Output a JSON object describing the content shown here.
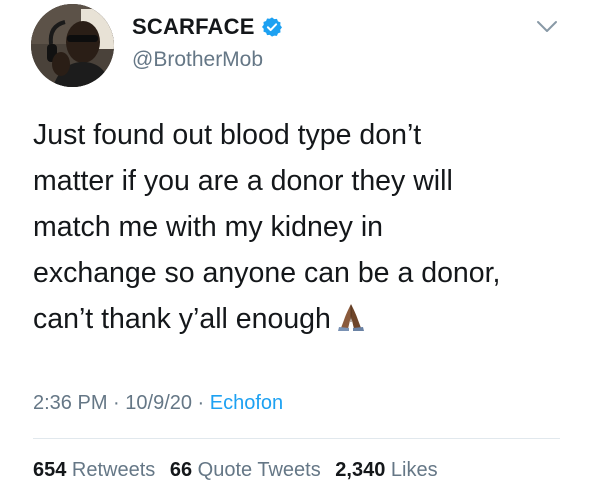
{
  "author": {
    "display_name": "SCARFACE",
    "handle": "@BrotherMob",
    "verified_icon": "verified-badge-icon",
    "accent_color": "#1da1f2"
  },
  "tweet": {
    "lines": [
      "Just found out blood type don’t",
      "matter if you are a donor they will",
      "match me with my kidney in",
      "exchange so anyone can be a donor,",
      "can’t thank y’all enough"
    ],
    "emoji": "folded-hands-icon"
  },
  "meta": {
    "time": "2:36 PM",
    "separator": " · ",
    "date": "10/9/20",
    "source": "Echofon"
  },
  "stats": {
    "retweets_count": "654",
    "retweets_label": " Retweets",
    "quotes_count": "66",
    "quotes_label": " Quote Tweets",
    "likes_count": "2,340",
    "likes_label": " Likes"
  }
}
